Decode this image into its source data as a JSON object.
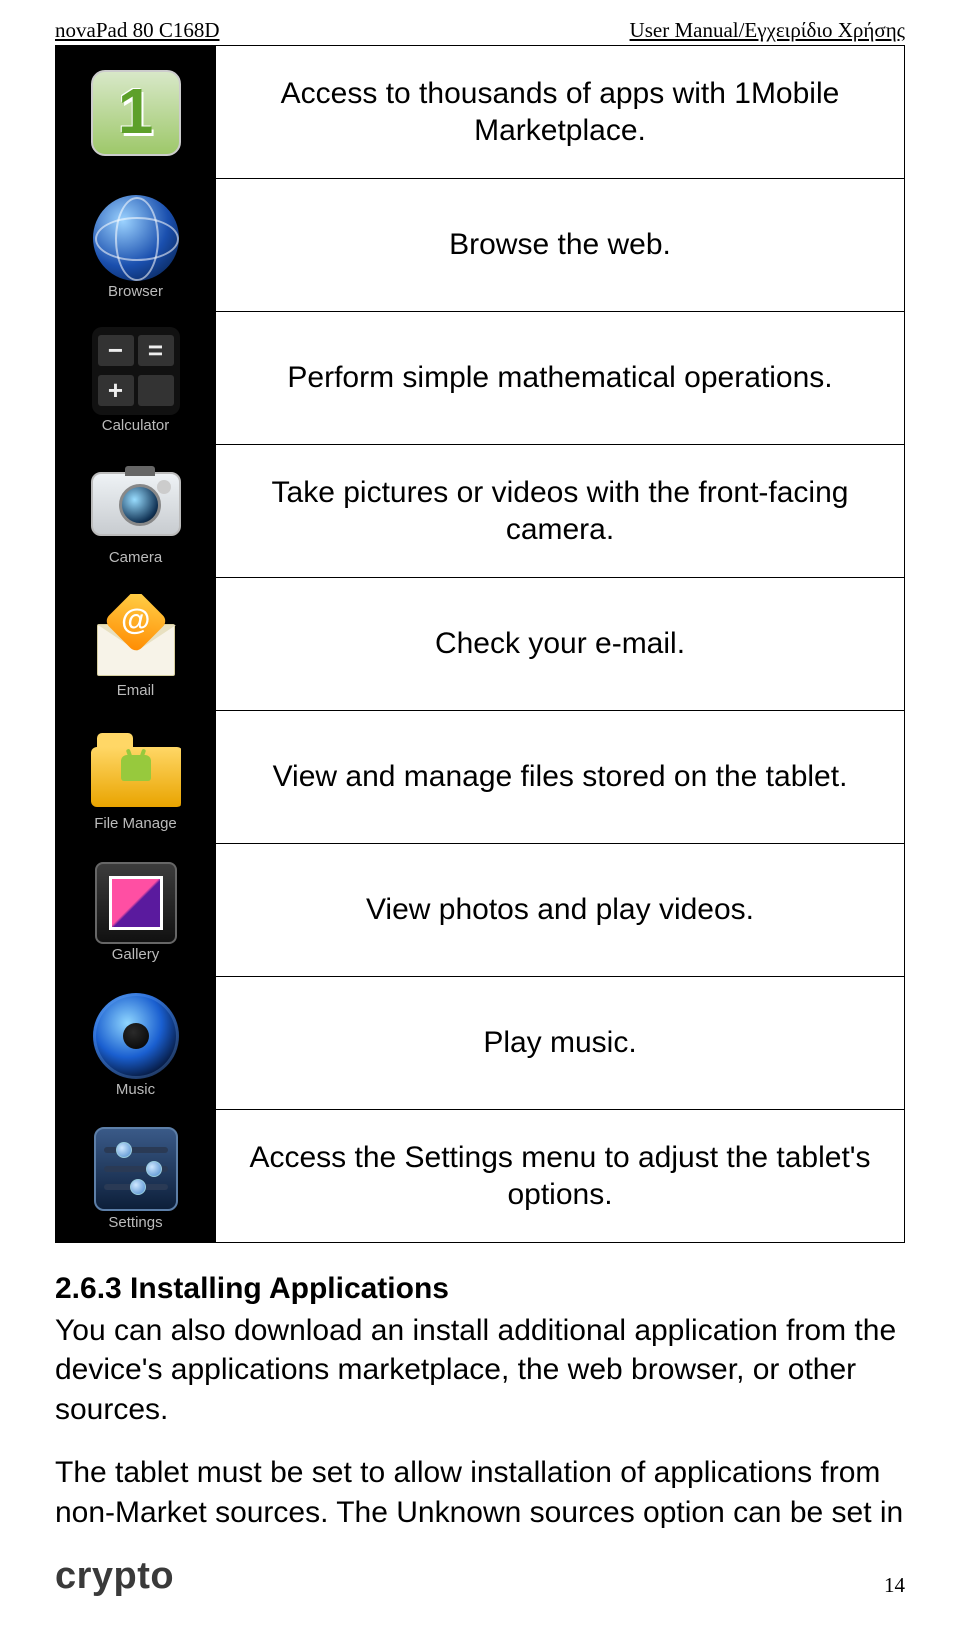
{
  "header": {
    "left": "novaPad 80 C168D",
    "right": "User Manual/Εγχειρίδιο Χρήσης"
  },
  "apps": [
    {
      "label": "",
      "desc": "Access to thousands of apps with 1Mobile Marketplace."
    },
    {
      "label": "Browser",
      "desc": "Browse the web."
    },
    {
      "label": "Calculator",
      "desc": "Perform simple mathematical operations."
    },
    {
      "label": "Camera",
      "desc": "Take pictures or videos with the front-facing camera."
    },
    {
      "label": "Email",
      "desc": "Check your e-mail."
    },
    {
      "label": "File Manage",
      "desc": "View and manage files stored on the tablet."
    },
    {
      "label": "Gallery",
      "desc": "View photos and play videos."
    },
    {
      "label": "Music",
      "desc": "Play music."
    },
    {
      "label": "Settings",
      "desc": "Access the Settings menu to adjust the tablet's options."
    }
  ],
  "section": {
    "heading": "2.6.3 Installing Applications",
    "p1": "You can also download an install additional application from the device's applications marketplace, the web browser, or other sources.",
    "p2": "The tablet must be set to allow installation of applications from non-Market sources. The Unknown sources option can be set in"
  },
  "footer": {
    "brand": "crypto",
    "page": "14"
  }
}
